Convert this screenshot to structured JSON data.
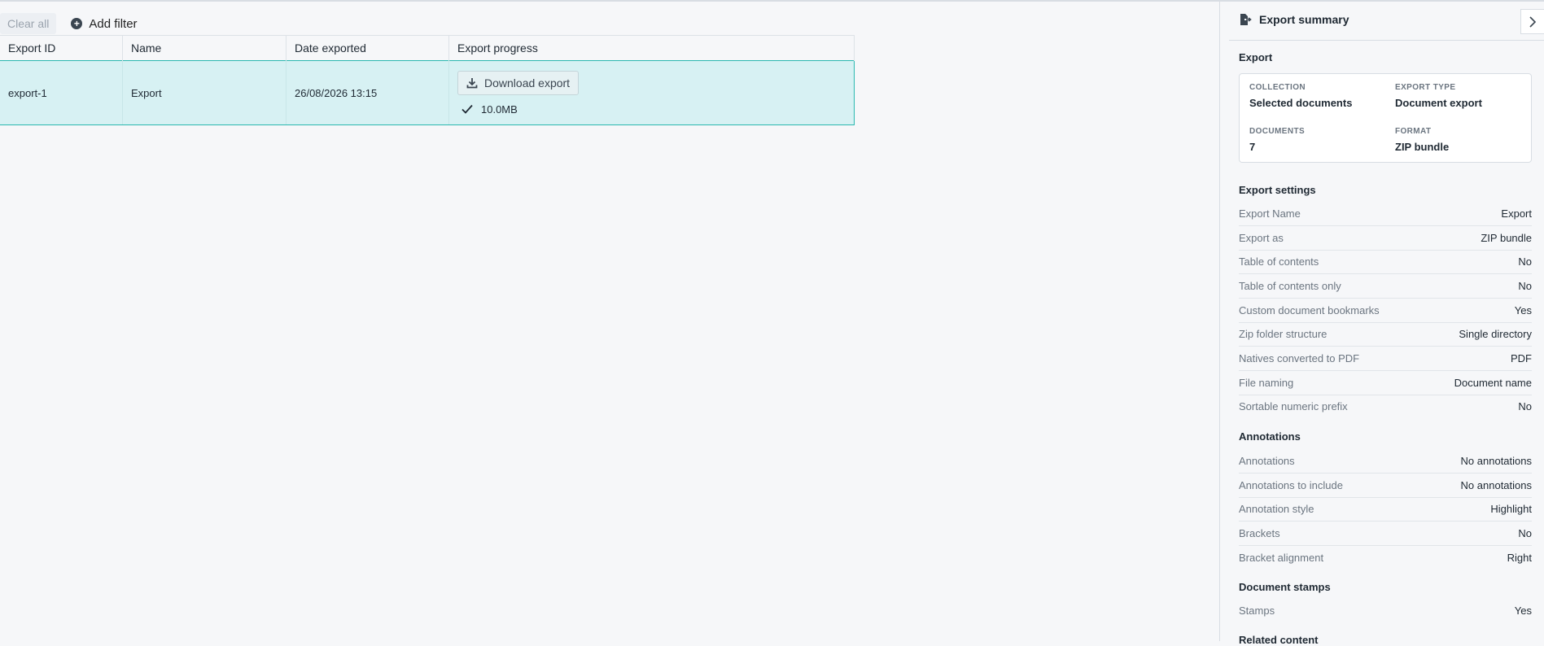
{
  "filters": {
    "clear_all": "Clear all",
    "add_filter": "Add filter"
  },
  "table": {
    "headers": [
      "Export ID",
      "Name",
      "Date exported",
      "Export progress"
    ],
    "rows": [
      {
        "id": "export-1",
        "name": "Export",
        "date": "26/08/2026 13:15",
        "download_label": "Download export",
        "size": "10.0MB"
      }
    ]
  },
  "panel": {
    "title": "Export summary",
    "export_section": "Export",
    "card": {
      "collection_label": "COLLECTION",
      "collection_value": "Selected documents",
      "type_label": "EXPORT TYPE",
      "type_value": "Document export",
      "documents_label": "DOCUMENTS",
      "documents_value": "7",
      "format_label": "FORMAT",
      "format_value": "ZIP bundle"
    },
    "settings_section": "Export settings",
    "settings": [
      {
        "k": "Export Name",
        "v": "Export"
      },
      {
        "k": "Export as",
        "v": "ZIP bundle"
      },
      {
        "k": "Table of contents",
        "v": "No"
      },
      {
        "k": "Table of contents only",
        "v": "No"
      },
      {
        "k": "Custom document bookmarks",
        "v": "Yes"
      },
      {
        "k": "Zip folder structure",
        "v": "Single directory"
      },
      {
        "k": "Natives converted to PDF",
        "v": "PDF"
      },
      {
        "k": "File naming",
        "v": "Document name"
      },
      {
        "k": "Sortable numeric prefix",
        "v": "No"
      }
    ],
    "annotations_section": "Annotations",
    "annotations": [
      {
        "k": "Annotations",
        "v": "No annotations"
      },
      {
        "k": "Annotations to include",
        "v": "No annotations"
      },
      {
        "k": "Annotation style",
        "v": "Highlight"
      },
      {
        "k": "Brackets",
        "v": "No"
      },
      {
        "k": "Bracket alignment",
        "v": "Right"
      }
    ],
    "stamps_section": "Document stamps",
    "stamps": [
      {
        "k": "Stamps",
        "v": "Yes"
      }
    ],
    "related_section": "Related content"
  },
  "colors": {
    "accent": "#2bb8b0",
    "selected_row": "#d7f1f3"
  }
}
